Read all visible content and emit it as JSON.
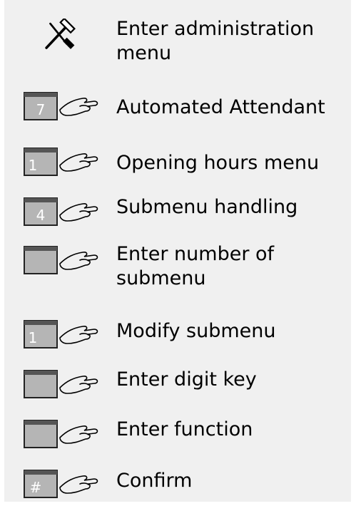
{
  "steps": [
    {
      "icon": "tools-icon",
      "key": "",
      "text": "Enter administration menu"
    },
    {
      "icon": "key-press-icon",
      "key": "7",
      "text": "Automated Attendant"
    },
    {
      "icon": "key-press-icon",
      "key": "1",
      "text": "Opening hours menu"
    },
    {
      "icon": "key-press-icon",
      "key": "4",
      "text": "Submenu handling"
    },
    {
      "icon": "key-press-icon",
      "key": "",
      "text": "Enter number of submenu"
    },
    {
      "icon": "key-press-icon",
      "key": "1",
      "text": "Modify submenu"
    },
    {
      "icon": "key-press-icon",
      "key": "",
      "text": "Enter digit key"
    },
    {
      "icon": "key-press-icon",
      "key": "",
      "text": "Enter function"
    },
    {
      "icon": "key-press-icon",
      "key": "#",
      "text": "Confirm"
    }
  ],
  "colors": {
    "panel": "#f0f0f0",
    "key_face": "#b5b5b5",
    "key_edge": "#222222"
  }
}
